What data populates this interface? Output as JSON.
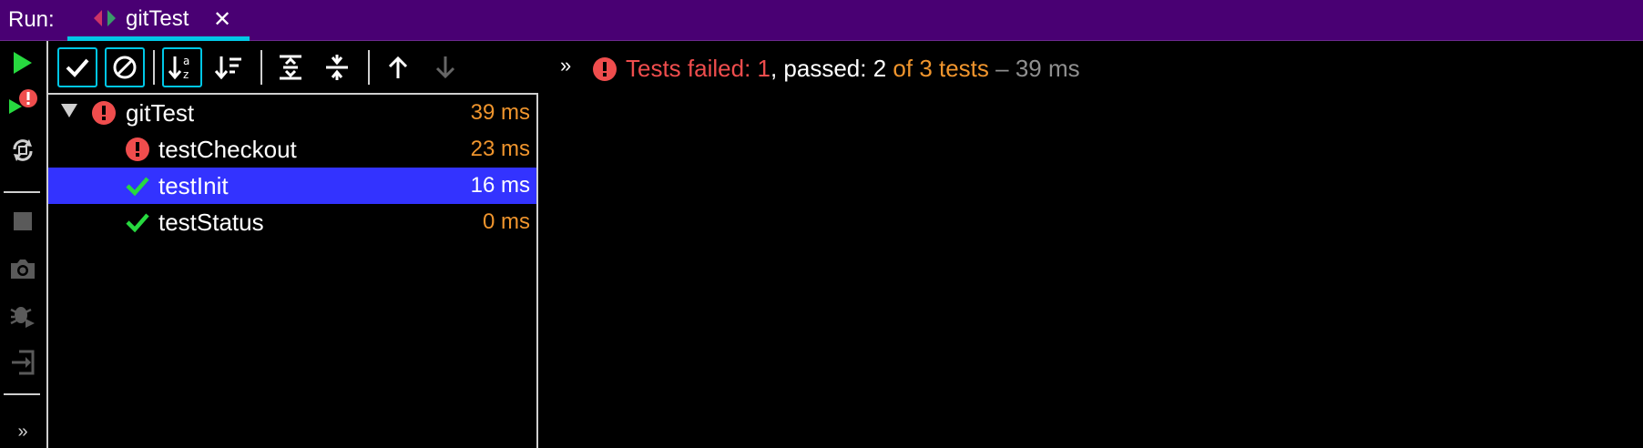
{
  "header": {
    "run_label": "Run:",
    "tab": {
      "title": "gitTest",
      "close": "✕"
    }
  },
  "toolbar": {
    "buttons": [
      {
        "name": "show-passed-icon"
      },
      {
        "name": "show-ignored-icon"
      },
      {
        "name": "sort-alphabetically-icon"
      },
      {
        "name": "sort-by-duration-icon"
      },
      {
        "name": "expand-all-icon"
      },
      {
        "name": "collapse-all-icon"
      },
      {
        "name": "previous-failed-test-icon"
      },
      {
        "name": "next-failed-test-icon"
      }
    ],
    "more": "»"
  },
  "status": {
    "failed_prefix": "Tests failed: ",
    "failed_count": "1",
    "passed_text": ", passed: 2",
    "of_text": " of 3 tests",
    "duration": " – 39 ms"
  },
  "tree": {
    "rows": [
      {
        "name": "gitTest",
        "time": "39 ms",
        "status": "failed"
      },
      {
        "name": "testCheckout",
        "time": "23 ms",
        "status": "failed"
      },
      {
        "name": "testInit",
        "time": "16 ms",
        "status": "passed"
      },
      {
        "name": "testStatus",
        "time": "0 ms",
        "status": "passed"
      }
    ]
  },
  "side_strip": {
    "more": "»"
  },
  "colors": {
    "header_bg": "#490073",
    "tab_accent": "#00c7e6",
    "selection": "#3333ff",
    "failed": "#ef4d4d",
    "passed": "#27d93f",
    "duration": "#f0952d"
  }
}
